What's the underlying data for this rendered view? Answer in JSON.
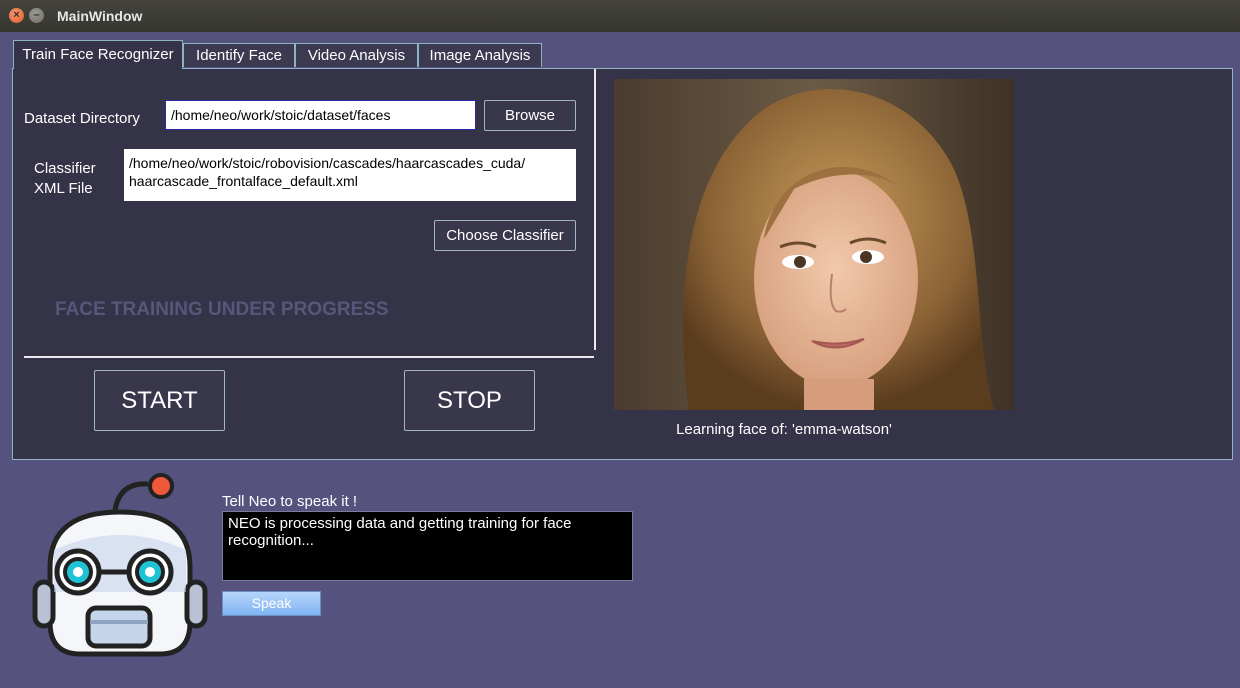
{
  "window": {
    "title": "MainWindow"
  },
  "tabs": [
    {
      "label": "Train Face Recognizer",
      "active": true
    },
    {
      "label": "Identify Face"
    },
    {
      "label": "Video Analysis"
    },
    {
      "label": "Image Analysis"
    }
  ],
  "train": {
    "dataset_label": "Dataset Directory",
    "dataset_value": "/home/neo/work/stoic/dataset/faces",
    "browse_label": "Browse",
    "classifier_label_line1": "Classifier",
    "classifier_label_line2": "XML File",
    "classifier_value_line1": "/home/neo/work/stoic/robovision/cascades/haarcascades_cuda/",
    "classifier_value_line2": "haarcascade_frontalface_default.xml",
    "choose_classifier_label": "Choose Classifier",
    "progress_text": "FACE TRAINING UNDER PROGRESS",
    "start_label": "START",
    "stop_label": "STOP",
    "caption": "Learning face of: 'emma-watson'"
  },
  "assistant": {
    "prompt_label": "Tell Neo to speak it !",
    "message": "NEO is processing data and getting training for face recognition...",
    "speak_label": "Speak"
  },
  "colors": {
    "window_bg": "#55527e",
    "panel_bg": "#353347",
    "accent_border": "#8fb3c4",
    "speak_button": "#9cc6f7",
    "robot_eye": "#1ec3d6",
    "robot_antenna": "#f0583a"
  }
}
